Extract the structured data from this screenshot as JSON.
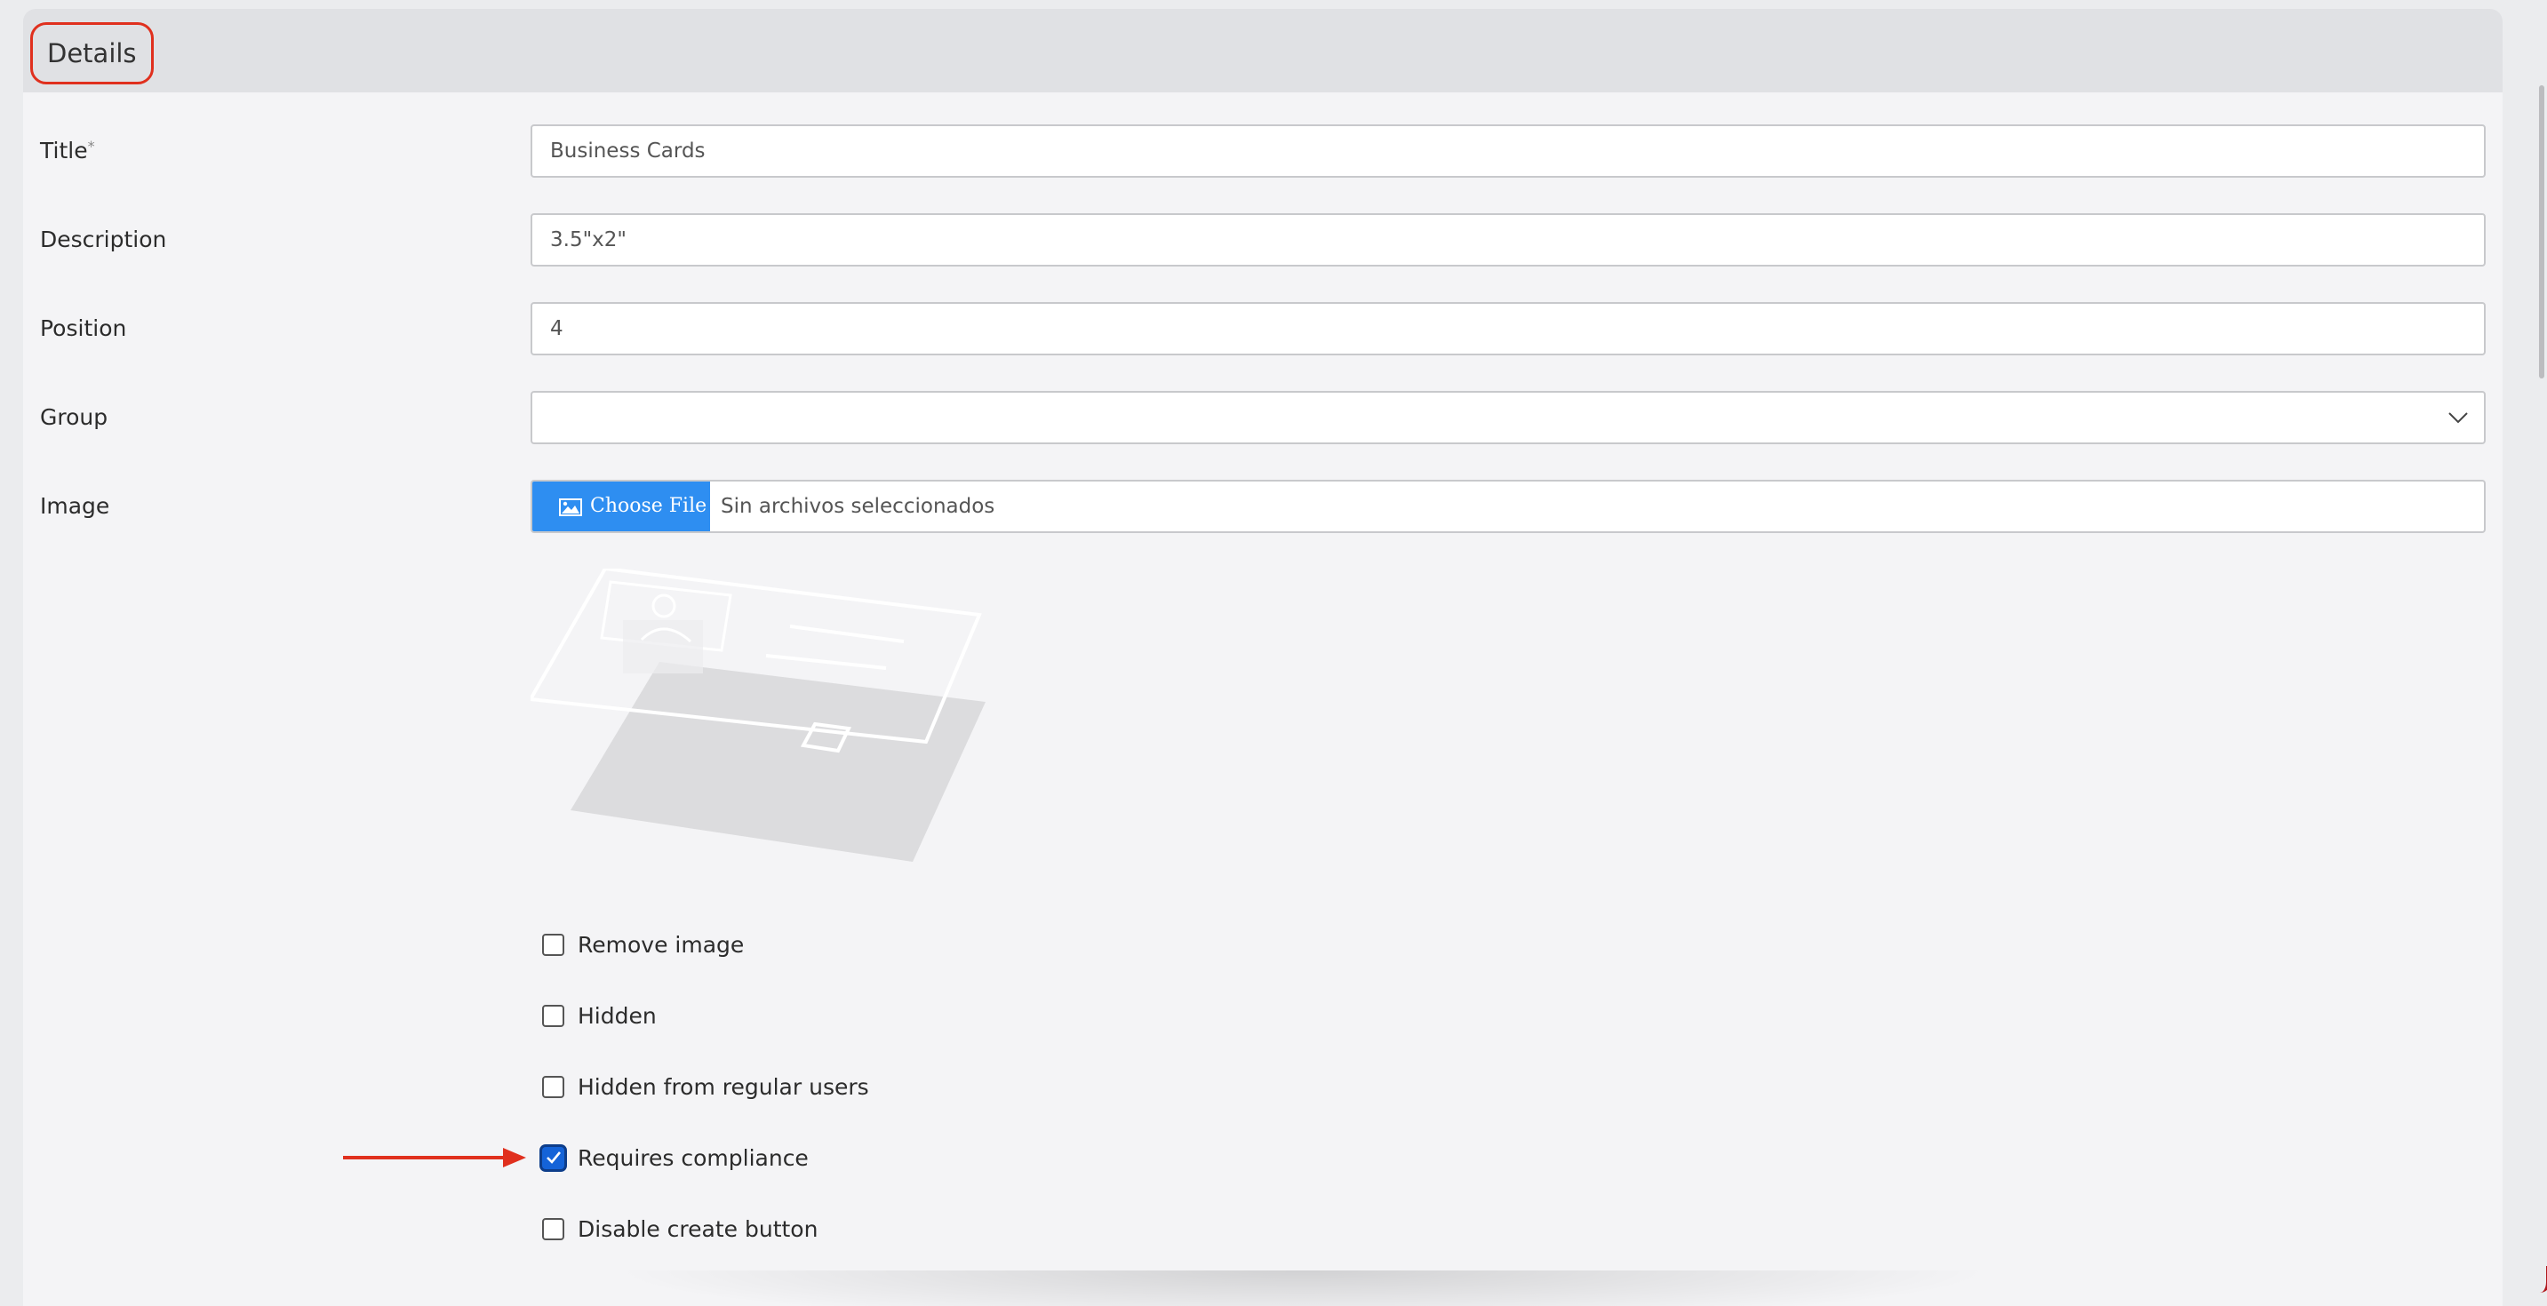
{
  "header": {
    "title": "Details"
  },
  "form": {
    "title": {
      "label": "Title",
      "required_mark": "*",
      "value": "Business Cards"
    },
    "description": {
      "label": "Description",
      "value": "3.5\"x2\""
    },
    "position": {
      "label": "Position",
      "value": "4"
    },
    "group": {
      "label": "Group",
      "value": ""
    },
    "image": {
      "label": "Image",
      "choose_button": "Choose File",
      "file_status": "Sin archivos seleccionados"
    }
  },
  "checkboxes": [
    {
      "label": "Remove image",
      "checked": false
    },
    {
      "label": "Hidden",
      "checked": false
    },
    {
      "label": "Hidden from regular users",
      "checked": false
    },
    {
      "label": "Requires compliance",
      "checked": true
    },
    {
      "label": "Disable create button",
      "checked": false
    }
  ],
  "icons": {
    "dropdown": "chevron-down-icon",
    "choose_file": "image-icon",
    "preview": "business-card-placeholder-icon",
    "annotation": "arrow-right-icon"
  },
  "colors": {
    "annotation": "#e0301e",
    "button": "#2e8ef1",
    "checked": "#1463d8"
  }
}
